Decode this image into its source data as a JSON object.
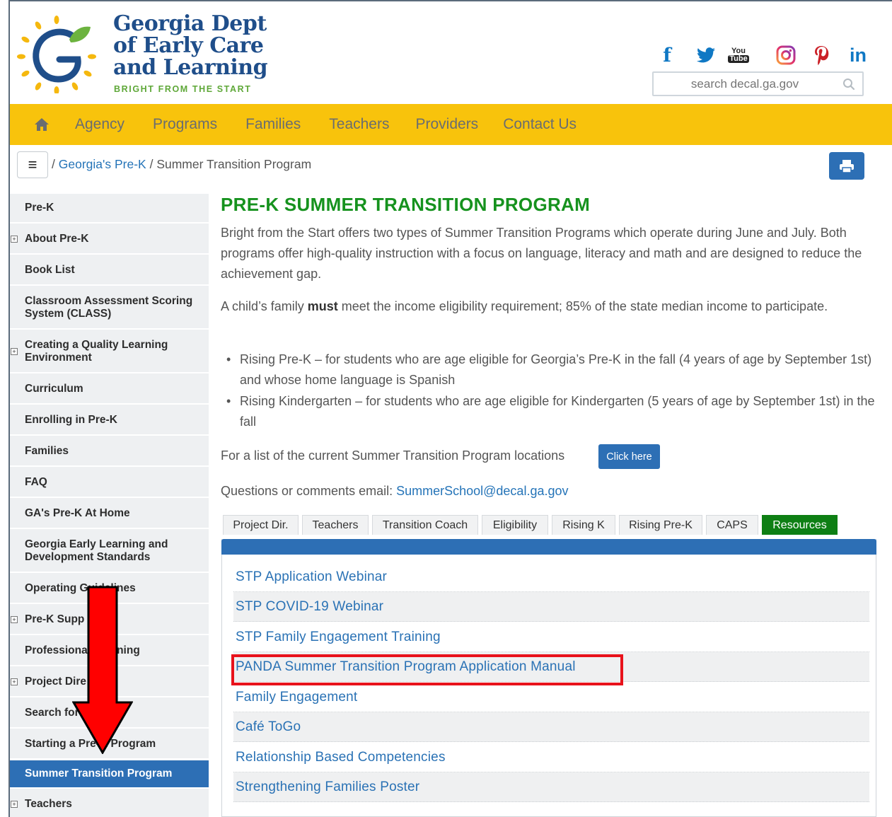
{
  "header": {
    "org_line1": "Georgia Dept",
    "org_line2": "of Early Care",
    "org_line3": "and Learning",
    "tagline": "BRIGHT FROM THE START",
    "social": [
      {
        "name": "facebook",
        "label": "f"
      },
      {
        "name": "twitter",
        "label": ""
      },
      {
        "name": "youtube",
        "label": "You Tube"
      },
      {
        "name": "instagram",
        "label": ""
      },
      {
        "name": "pinterest",
        "label": "p"
      },
      {
        "name": "linkedin",
        "label": "in"
      }
    ],
    "search_placeholder": "search decal.ga.gov"
  },
  "nav": {
    "items": [
      "Agency",
      "Programs",
      "Families",
      "Teachers",
      "Providers",
      "Contact Us"
    ]
  },
  "breadcrumb": {
    "sep1": "/",
    "link": "Georgia's Pre-K",
    "sep2": "/",
    "current": "Summer Transition Program"
  },
  "sidebar": {
    "items": [
      {
        "label": "Pre-K",
        "expandable": false
      },
      {
        "label": "About Pre-K",
        "expandable": true
      },
      {
        "label": "Book List",
        "expandable": false
      },
      {
        "label": "Classroom Assessment Scoring System (CLASS)",
        "expandable": false
      },
      {
        "label": "Creating a Quality Learning Environment",
        "expandable": true
      },
      {
        "label": "Curriculum",
        "expandable": false
      },
      {
        "label": "Enrolling in Pre-K",
        "expandable": false
      },
      {
        "label": "Families",
        "expandable": false
      },
      {
        "label": "FAQ",
        "expandable": false
      },
      {
        "label": "GA's Pre-K At Home",
        "expandable": false
      },
      {
        "label": "Georgia Early Learning and Development Standards",
        "expandable": false
      },
      {
        "label": "Operating Guidelines",
        "expandable": false
      },
      {
        "label": "Pre-K Supp",
        "expandable": true
      },
      {
        "label": "Professional Learning",
        "expandable": false
      },
      {
        "label": "Project Dire",
        "expandable": true
      },
      {
        "label": "Search for P",
        "expandable": false
      },
      {
        "label": "Starting a Pre-K Program",
        "expandable": false
      },
      {
        "label": "Summer Transition Program",
        "expandable": false,
        "active": true
      },
      {
        "label": "Teachers",
        "expandable": true
      }
    ]
  },
  "main": {
    "title": "PRE-K SUMMER TRANSITION PROGRAM",
    "intro": "Bright from the Start offers two types of Summer Transition Programs which operate during June and July. Both programs offer high-quality instruction with a focus on language, literacy and math and are designed to reduce the achievement gap.",
    "eligibility_prefix": "A child’s family ",
    "eligibility_bold": "must",
    "eligibility_suffix": " meet the income eligibility requirement; 85% of the state median income to participate.",
    "bullets": [
      "Rising Pre-K – for students who are age eligible for Georgia’s Pre-K in the fall (4 years of age by September 1st) and whose home language is Spanish",
      "Rising Kindergarten – for students who are age eligible for Kindergarten (5 years of age by September 1st) in the fall"
    ],
    "locations_text": "For a list of the current Summer Transition Program locations",
    "click_here": "Click here",
    "questions_text": "Questions or comments email: ",
    "email": "SummerSchool@decal.ga.gov"
  },
  "tabs": [
    {
      "label": "Project Dir."
    },
    {
      "label": "Teachers"
    },
    {
      "label": "Transition Coach"
    },
    {
      "label": "Eligibility"
    },
    {
      "label": "Rising K"
    },
    {
      "label": "Rising Pre-K"
    },
    {
      "label": "CAPS"
    },
    {
      "label": "Resources",
      "active": true
    }
  ],
  "resources": [
    "STP Application Webinar",
    "STP COVID-19 Webinar",
    "STP Family Engagement Training",
    "PANDA Summer Transition Program Application Manual",
    "Family Engagement",
    "Café ToGo",
    "Relationship Based Competencies",
    "Strengthening Families Poster"
  ],
  "colors": {
    "nav_bg": "#f8c30c",
    "brand_blue": "#2d6fb5",
    "title_green": "#16921e",
    "active_tab": "#0e7f14",
    "annotation_red": "#e8121b"
  },
  "annotations": {
    "highlight_target": "PANDA Summer Transition Program Application Manual",
    "arrow_target": "Summer Transition Program"
  }
}
